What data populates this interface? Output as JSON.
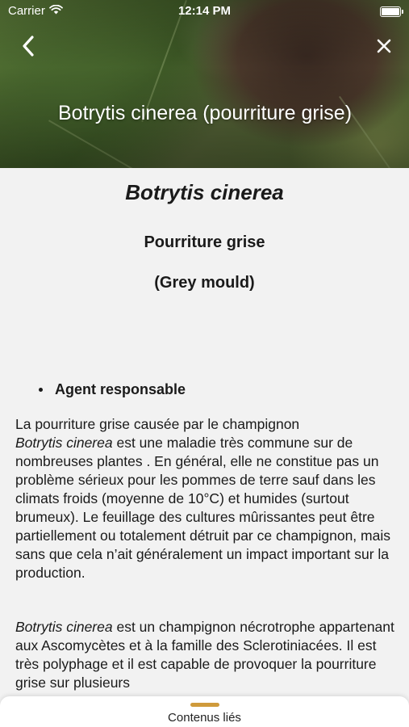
{
  "status_bar": {
    "carrier": "Carrier",
    "time": "12:14 PM",
    "wifi_icon": "wifi-icon",
    "battery_icon": "battery-icon"
  },
  "header": {
    "back_icon": "chevron-left-icon",
    "close_icon": "close-icon",
    "title": "Botrytis cinerea  (pourriture grise)"
  },
  "article": {
    "scientific_name": "Botrytis cinerea",
    "common_name_fr": "Pourriture grise",
    "common_name_en": "(Grey mould)",
    "section_heading": "Agent responsable",
    "paragraph1": {
      "line1": "La pourriture grise causée par le champignon",
      "italic": "Botrytis cinerea",
      "rest": " est une maladie très commune sur de nombreuses plantes . En général, elle ne constitue pas un problème sérieux pour les pommes de terre sauf dans les climats froids (moyenne de 10°C) et humides (surtout brumeux). Le feuillage des cultures mûrissantes peut être partiellement ou totalement détruit par ce champignon, mais sans que cela n’ait généralement un impact important sur la production."
    },
    "paragraph2": {
      "italic": "Botrytis cinerea",
      "rest": " est un champignon nécrotrophe appartenant aux Ascomycètes et à la famille des Sclerotiniacées. Il est très polyphage et il est capable de provoquer la pourriture grise sur plusieurs"
    }
  },
  "bottom_sheet": {
    "label": "Contenus liés"
  },
  "colors": {
    "accent": "#cf9a3b",
    "background": "#f2f2f2"
  }
}
